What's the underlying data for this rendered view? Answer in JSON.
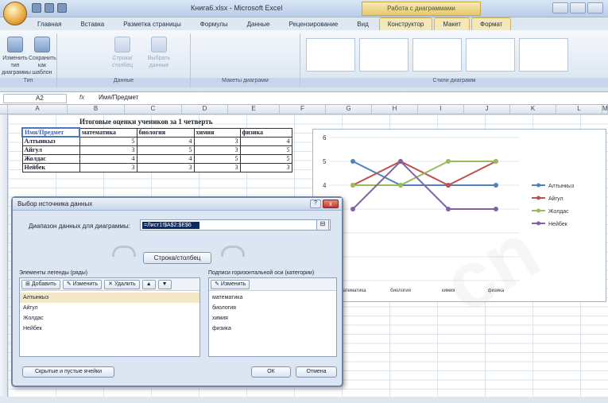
{
  "window": {
    "title": "Книга6.xlsx - Microsoft Excel",
    "context_tab_group": "Работа с диаграммами"
  },
  "ribbon": {
    "tabs": [
      "Главная",
      "Вставка",
      "Разметка страницы",
      "Формулы",
      "Данные",
      "Рецензирование",
      "Вид",
      "Конструктор",
      "Макет",
      "Формат"
    ],
    "buttons": [
      {
        "label": "Изменить тип диаграммы"
      },
      {
        "label": "Сохранить как шаблон"
      },
      {
        "label": "Строка/столбец"
      },
      {
        "label": "Выбрать данные"
      }
    ],
    "groups": [
      "Тип",
      "Данные",
      "Макеты диаграмм",
      "Стили диаграмм"
    ]
  },
  "formula_bar": {
    "cell": "A2",
    "fx": "fx",
    "value": "Имя/Предмет"
  },
  "columns": [
    "",
    "A",
    "B",
    "C",
    "D",
    "E",
    "F",
    "G",
    "H",
    "I",
    "J",
    "K",
    "L",
    "M"
  ],
  "sheet": {
    "title": "Итоговые оценки учеников за 1 четверть",
    "headers": [
      "Имя/Предмет",
      "математика",
      "биология",
      "химия",
      "физика"
    ],
    "rows": [
      {
        "name": "Алтынкыз",
        "values": [
          5,
          4,
          3,
          4
        ]
      },
      {
        "name": "Айгул",
        "values": [
          3,
          5,
          3,
          5
        ]
      },
      {
        "name": "Жолдас",
        "values": [
          4,
          4,
          5,
          5
        ]
      },
      {
        "name": "Нейбек",
        "values": [
          3,
          3,
          3,
          3
        ]
      }
    ]
  },
  "chart_data": {
    "type": "line",
    "categories": [
      "математика",
      "биология",
      "химия",
      "физика"
    ],
    "series": [
      {
        "name": "Алтынкыз",
        "values": [
          5,
          4,
          4,
          4
        ],
        "color": "#4f81bd"
      },
      {
        "name": "Айгул",
        "values": [
          4,
          5,
          4,
          5
        ],
        "color": "#c0504d"
      },
      {
        "name": "Жолдас",
        "values": [
          4,
          4,
          5,
          5
        ],
        "color": "#9bbb59"
      },
      {
        "name": "Нейбек",
        "values": [
          3,
          5,
          3,
          3
        ],
        "color": "#8064a2"
      }
    ],
    "ylim": [
      0,
      6
    ],
    "ylabels": [
      "6",
      "5",
      "4"
    ],
    "legend": "right"
  },
  "dialog": {
    "title": "Выбор источника данных",
    "help": "?",
    "close": "x",
    "range_label": "Диапазон данных для диаграммы:",
    "range_value": "=Лист1!$A$2:$E$6",
    "switch_label": "Строка/столбец",
    "legend_pane_label": "Элементы легенды (ряды)",
    "add": "Добавить",
    "edit": "Изменить",
    "remove": "Удалить",
    "up": "▲",
    "down": "▼",
    "axis_pane_label": "Подписи горизонтальной оси (категории)",
    "axis_edit": "Изменить",
    "series": [
      "Алтынкыз",
      "Айгул",
      "Жолдас",
      "Нейбек"
    ],
    "categories": [
      "математика",
      "биология",
      "химия",
      "физика"
    ],
    "hidden_btn": "Скрытые и пустые ячейки",
    "ok": "ОК",
    "cancel": "Отмена"
  },
  "colors": {
    "accent": "#4a76c2",
    "title_bar": "#c6d6ea"
  }
}
